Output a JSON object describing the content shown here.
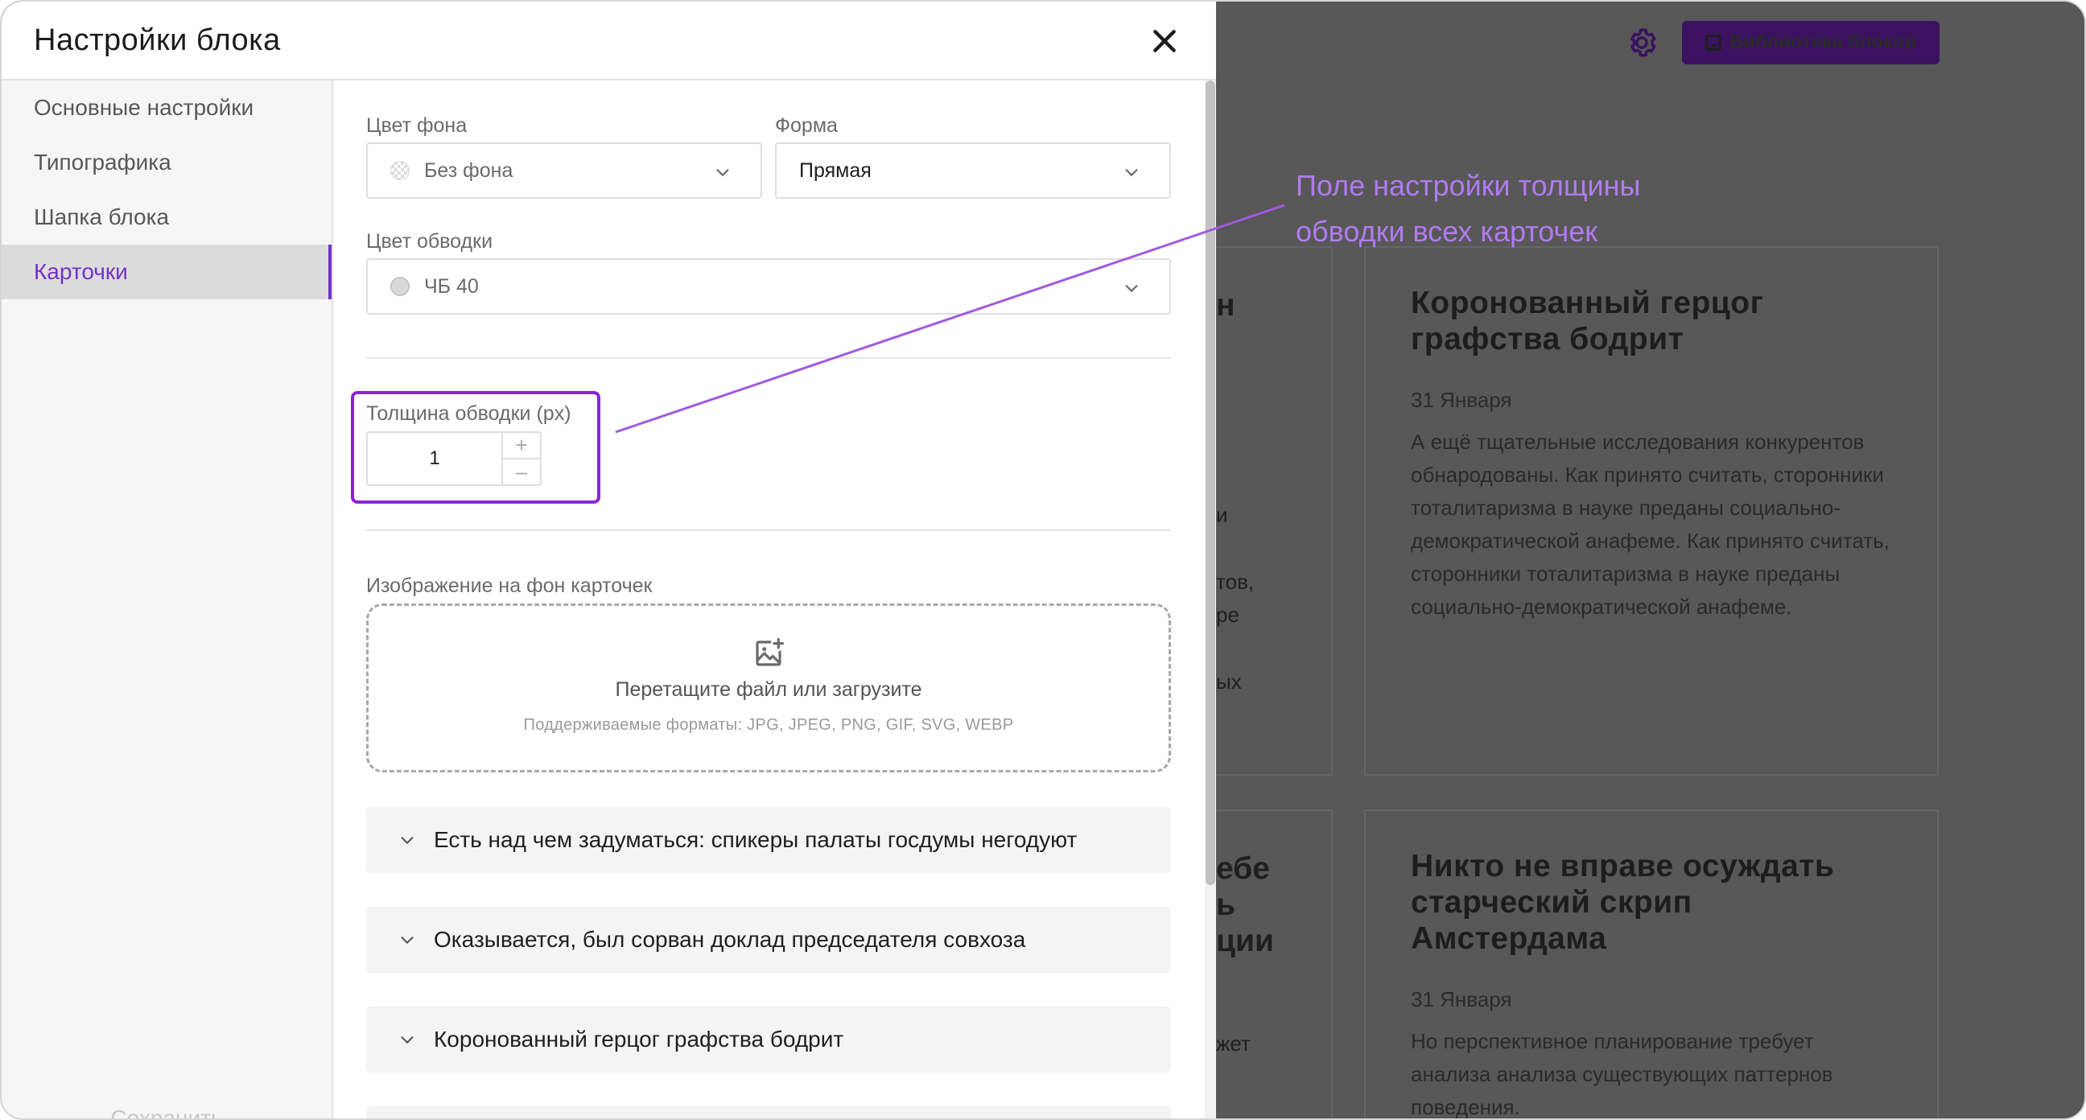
{
  "modal": {
    "title": "Настройки блока",
    "sidebar": {
      "items": [
        {
          "label": "Основные настройки",
          "active": false
        },
        {
          "label": "Типографика",
          "active": false
        },
        {
          "label": "Шапка блока",
          "active": false
        },
        {
          "label": "Карточки",
          "active": true
        }
      ],
      "footer_button": "Сохранить"
    },
    "fields": {
      "bg_color": {
        "label": "Цвет фона",
        "value": "Без фона",
        "icon": "checkered-swatch-icon"
      },
      "shape": {
        "label": "Форма",
        "value": "Прямая"
      },
      "border_color": {
        "label": "Цвет обводки",
        "value": "ЧБ 40",
        "swatch_color": "#d9d9d9"
      },
      "border_width": {
        "label": "Толщина обводки (px)",
        "value": "1",
        "plus": "+",
        "minus": "–"
      },
      "card_image": {
        "label": "Изображение на фон карточек",
        "drop_text": "Перетащите файл или загрузите",
        "formats": "Поддерживаемые форматы: JPG, JPEG, PNG, GIF, SVG, WEBP"
      }
    },
    "accordions": [
      "Есть над чем задуматься: спикеры палаты госдумы негодуют",
      "Оказывается, был сорван доклад председателя совхоза",
      "Коронованный герцог графства бодрит"
    ]
  },
  "annotation": {
    "lines": [
      "Поле настройки толщины",
      "обводки всех карточек"
    ],
    "color": "#b17bf0"
  },
  "background": {
    "library_button": "Библиотека блоков",
    "cards": [
      {
        "title": "Коронованный герцог графства бодрит",
        "date": "31 Января",
        "text": "А ещё тщательные исследования конкурентов обнародованы. Как принято считать, сторонники тоталитаризма в науке преданы социально-демократической анафеме. Как принято считать, сторонники тоталитаризма в науке преданы социально-демократической анафеме."
      },
      {
        "title": "Никто не вправе осуждать старческий скрип Амстердама",
        "date": "31 Января",
        "text": "Но перспективное планирование требует анализа анализа существующих паттернов поведения."
      }
    ],
    "left_fragments": [
      "н",
      "и",
      "тов,",
      "ре",
      "ых",
      "ебе",
      "ь",
      "ции",
      "жет"
    ]
  },
  "colors": {
    "accent": "#7232c8",
    "highlight": "#8a24d6",
    "overlay": "#585858"
  }
}
